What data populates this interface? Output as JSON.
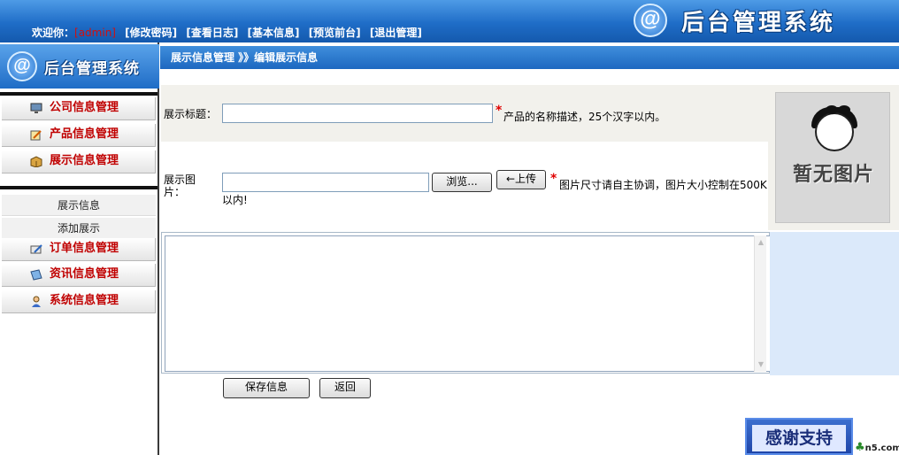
{
  "header": {
    "welcome_label": "欢迎你：",
    "username": "[admin]",
    "links": [
      "[修改密码]",
      "[查看日志]",
      "[基本信息]",
      "[预览前台]",
      "[退出管理]"
    ],
    "system_title": "后台管理系统",
    "logo_glyph": "@"
  },
  "sidebar": {
    "logo_glyph": "@",
    "title": "后台管理系统",
    "menu_top": [
      {
        "label": "公司信息管理",
        "icon": "monitor-icon"
      },
      {
        "label": "产品信息管理",
        "icon": "edit-note-icon"
      },
      {
        "label": "展示信息管理",
        "icon": "package-icon"
      }
    ],
    "sub_items": [
      "展示信息",
      "添加展示"
    ],
    "menu_bottom": [
      {
        "label": "订单信息管理",
        "icon": "order-edit-icon"
      },
      {
        "label": "资讯信息管理",
        "icon": "news-icon"
      },
      {
        "label": "系统信息管理",
        "icon": "user-icon"
      }
    ]
  },
  "breadcrumb": {
    "text": "展示信息管理 》》编辑展示信息"
  },
  "form": {
    "title_label": "展示标题：",
    "title_value": "",
    "title_hint": "产品的名称描述，25个汉字以内。",
    "image_label_line1": "展示图",
    "image_label_line2": "片：",
    "image_value": "",
    "browse_label": "浏览...",
    "upload_label": "←上传",
    "image_hint_line1": "图片尺寸请自主协调，图片大小控制在500K",
    "image_hint_line2": "以内!",
    "required_mark": "*",
    "preview_text": "暂无图片",
    "content_value": "",
    "save_label": "保存信息",
    "back_label": "返回"
  },
  "support": {
    "label": "感谢支持",
    "site_suffix": "n5.com"
  },
  "colors": {
    "header_blue": "#1f6dc7",
    "menu_red": "#c00000",
    "required_red": "#e00000",
    "username_red": "#d01010"
  }
}
